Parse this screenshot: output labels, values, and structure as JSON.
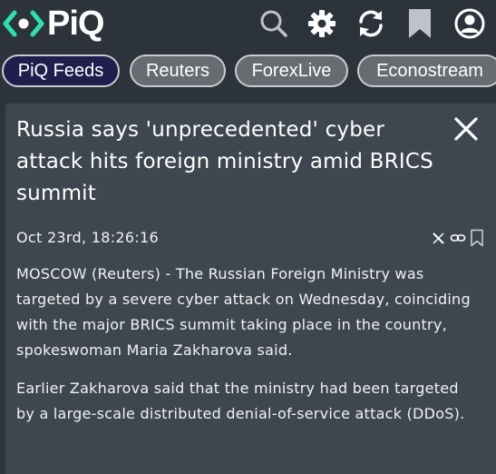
{
  "header": {
    "logo_text": "PiQ",
    "icons": [
      "search-icon",
      "settings-gear-icon",
      "refresh-icon",
      "bookmark-icon",
      "account-icon"
    ]
  },
  "tabs": [
    {
      "label": "PiQ Feeds",
      "active": true
    },
    {
      "label": "Reuters",
      "active": false
    },
    {
      "label": "ForexLive",
      "active": false
    },
    {
      "label": "Econostream",
      "active": false
    }
  ],
  "article": {
    "title": "Russia says 'unprecedented' cyber attack hits foreign ministry amid BRICS summit",
    "timestamp": "Oct 23rd, 18:26:16",
    "share_icons": [
      "x-icon",
      "link-icon",
      "bookmark-icon"
    ],
    "paragraphs": [
      "MOSCOW (Reuters) - The Russian Foreign Ministry was targeted by a severe cyber attack on Wednesday, coinciding with the major BRICS summit taking place in the country, spokeswoman Maria Zakharova said.",
      "Earlier Zakharova said that the ministry had been targeted by a large-scale distributed denial-of-service attack (DDoS)."
    ]
  },
  "colors": {
    "background": "#2c333b",
    "card": "#3e4750",
    "tab": "#676c70",
    "tab_active": "#1f1f4e",
    "accent": "#2de0b4"
  }
}
